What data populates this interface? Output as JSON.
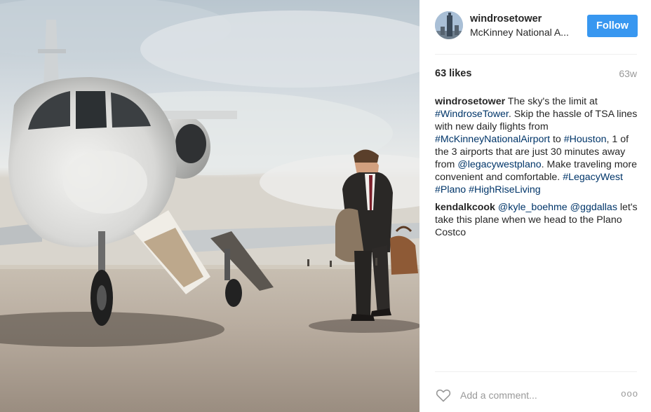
{
  "post": {
    "username": "windrosetower",
    "location": "McKinney National A...",
    "follow_label": "Follow",
    "likes": "63 likes",
    "time_ago": "63w",
    "caption": [
      {
        "type": "user",
        "text": "windrosetower"
      },
      {
        "type": "text",
        "text": " The sky's the limit at "
      },
      {
        "type": "tag",
        "text": "#WindroseTower"
      },
      {
        "type": "text",
        "text": ". Skip the hassle of TSA lines with new daily flights from "
      },
      {
        "type": "tag",
        "text": "#McKinneyNationalAirport"
      },
      {
        "type": "text",
        "text": " to "
      },
      {
        "type": "tag",
        "text": "#Houston"
      },
      {
        "type": "text",
        "text": ", 1 of the 3 airports that are just 30 minutes away from "
      },
      {
        "type": "tag",
        "text": "@legacywestplano"
      },
      {
        "type": "text",
        "text": ". Make traveling more convenient and comfortable. "
      },
      {
        "type": "tag",
        "text": "#LegacyWest"
      },
      {
        "type": "text",
        "text": " "
      },
      {
        "type": "tag",
        "text": "#Plano"
      },
      {
        "type": "text",
        "text": " "
      },
      {
        "type": "tag",
        "text": "#HighRiseLiving"
      }
    ],
    "comments": [
      [
        {
          "type": "user",
          "text": "kendalkcook"
        },
        {
          "type": "text",
          "text": " "
        },
        {
          "type": "tag",
          "text": "@kyle_boehme"
        },
        {
          "type": "text",
          "text": " "
        },
        {
          "type": "tag",
          "text": "@ggdallas"
        },
        {
          "type": "text",
          "text": " let's take this plane when we head to the Plano Costco"
        }
      ]
    ],
    "comment_placeholder": "Add a comment...",
    "more_label": "ooo"
  },
  "icons": {
    "like": "heart-outline-icon",
    "more": "more-options-icon"
  },
  "colors": {
    "follow_button": "#3897f0",
    "hashtag": "#003569",
    "muted": "#999999"
  }
}
